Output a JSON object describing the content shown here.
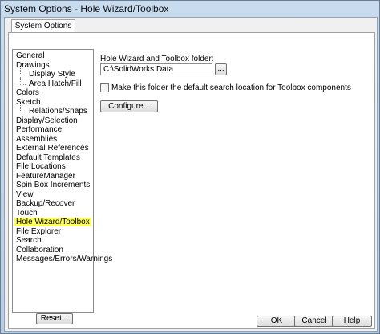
{
  "window": {
    "title": "System Options - Hole Wizard/Toolbox"
  },
  "tab": {
    "label": "System Options"
  },
  "tree": {
    "items": [
      {
        "label": "General",
        "indent": false
      },
      {
        "label": "Drawings",
        "indent": false
      },
      {
        "label": "Display Style",
        "indent": true
      },
      {
        "label": "Area Hatch/Fill",
        "indent": true
      },
      {
        "label": "Colors",
        "indent": false
      },
      {
        "label": "Sketch",
        "indent": false
      },
      {
        "label": "Relations/Snaps",
        "indent": true
      },
      {
        "label": "Display/Selection",
        "indent": false
      },
      {
        "label": "Performance",
        "indent": false
      },
      {
        "label": "Assemblies",
        "indent": false
      },
      {
        "label": "External References",
        "indent": false
      },
      {
        "label": "Default Templates",
        "indent": false
      },
      {
        "label": "File Locations",
        "indent": false
      },
      {
        "label": "FeatureManager",
        "indent": false
      },
      {
        "label": "Spin Box Increments",
        "indent": false
      },
      {
        "label": "View",
        "indent": false
      },
      {
        "label": "Backup/Recover",
        "indent": false
      },
      {
        "label": "Touch",
        "indent": false
      },
      {
        "label": "Hole Wizard/Toolbox",
        "indent": false,
        "selected": true
      },
      {
        "label": "File Explorer",
        "indent": false
      },
      {
        "label": "Search",
        "indent": false
      },
      {
        "label": "Collaboration",
        "indent": false
      },
      {
        "label": "Messages/Errors/Warnings",
        "indent": false
      }
    ],
    "selected_color": "#fdfd5c"
  },
  "panel": {
    "folder_label": "Hole Wizard and Toolbox folder:",
    "folder_value": "C:\\SolidWorks Data",
    "browse_label": "...",
    "checkbox_label": "Make this folder the default search location for Toolbox components",
    "checkbox_checked": false,
    "configure_label": "Configure..."
  },
  "buttons": {
    "reset": "Reset...",
    "ok": "OK",
    "cancel": "Cancel",
    "help": "Help"
  }
}
